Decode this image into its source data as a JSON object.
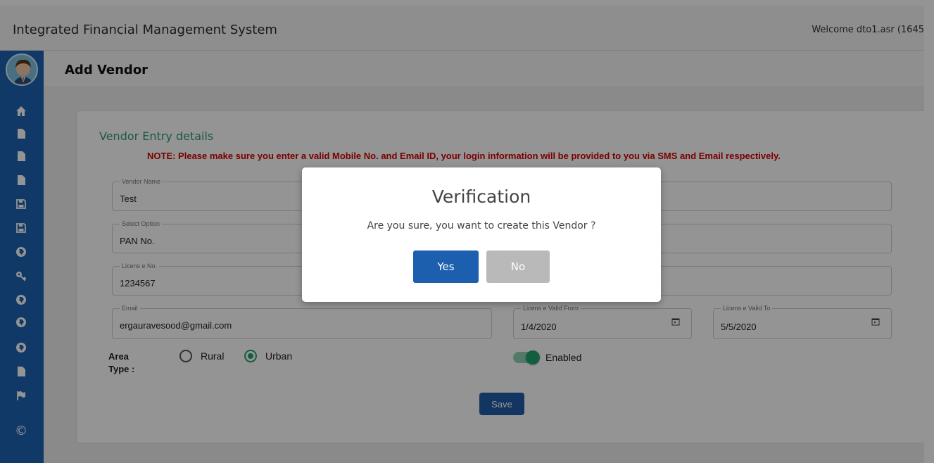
{
  "header": {
    "app_title": "Integrated Financial Management System",
    "welcome": "Welcome dto1.asr (1645"
  },
  "sidebar": {
    "icons": [
      "home-icon",
      "file-icon",
      "file-icon",
      "file-icon",
      "save-icon",
      "save-icon",
      "globe-icon",
      "key-icon",
      "globe-icon",
      "globe-icon",
      "globe-icon",
      "file-icon",
      "flag-icon"
    ],
    "footer_symbol": "©"
  },
  "page": {
    "title": "Add Vendor"
  },
  "form": {
    "section_title": "Vendor Entry details",
    "note": "NOTE: Please make sure you enter a valid Mobile No. and Email ID, your login information will be provided to you via SMS and Email respectively.",
    "vendor_name": {
      "label": "Vendor Name",
      "value": "Test"
    },
    "select_option": {
      "label": "Select Option",
      "value": "PAN No."
    },
    "license_no": {
      "label": "Licens e No.",
      "value": "1234567"
    },
    "email": {
      "label": "Email",
      "value": "ergauravesood@gmail.com"
    },
    "license_valid_from": {
      "label": "Licens e Valid From",
      "value": "1/4/2020"
    },
    "license_valid_to": {
      "label": "Licens e Valid To",
      "value": "5/5/2020"
    },
    "area_type": {
      "label_line1": "Area",
      "label_line2": "Type :",
      "options": [
        "Rural",
        "Urban"
      ],
      "selected": "Urban"
    },
    "toggle_label": "Enabled",
    "save_label": "Save"
  },
  "dialog": {
    "title": "Verification",
    "message": "Are you sure, you want to create this Vendor ?",
    "yes_label": "Yes",
    "no_label": "No"
  },
  "colors": {
    "sidebar": "#1e62b3",
    "accent_green": "#22a36b",
    "note_red": "#d40000",
    "primary_button": "#1d5faf"
  }
}
